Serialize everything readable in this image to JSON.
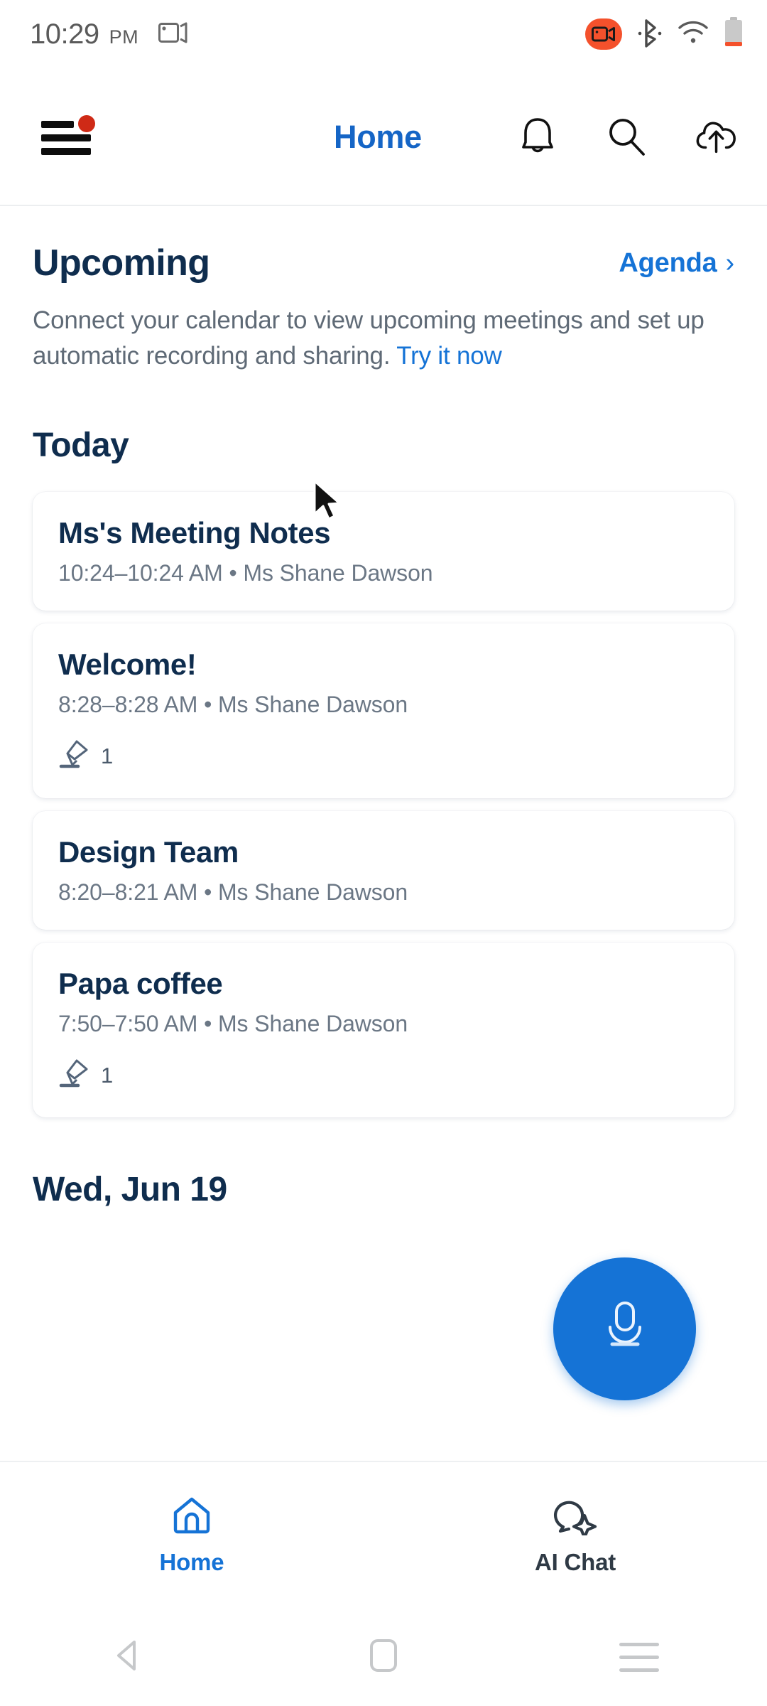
{
  "status_bar": {
    "time": "10:29",
    "ampm": "PM",
    "icons": [
      "screen-cast-icon",
      "screen-record-icon",
      "bluetooth-icon",
      "wifi-icon",
      "battery-icon"
    ],
    "record_color": "#f4512c",
    "battery_color": "#f4512c"
  },
  "app_bar": {
    "menu_icon": "hamburger-menu-icon",
    "menu_badge": true,
    "badge_color": "#cf2a16",
    "title": "Home",
    "title_color": "#1565c6",
    "actions": [
      {
        "name": "notifications-bell-icon",
        "label": "Notifications"
      },
      {
        "name": "search-icon",
        "label": "Search"
      },
      {
        "name": "cloud-upload-icon",
        "label": "Upload"
      }
    ]
  },
  "upcoming": {
    "title": "Upcoming",
    "action_label": "Agenda",
    "action_chevron": "›",
    "description_prefix": "Connect your calendar to view upcoming meetings and set up automatic recording and sharing. ",
    "description_link": "Try it now",
    "accent_color": "#1573d6"
  },
  "today": {
    "heading": "Today",
    "meetings": [
      {
        "title": "Ms's Meeting Notes",
        "time": "10:24–10:24 AM",
        "separator": "•",
        "owner": "Ms Shane Dawson",
        "has_highlight": false,
        "highlight_count": ""
      },
      {
        "title": "Welcome!",
        "time": "8:28–8:28 AM",
        "separator": "•",
        "owner": "Ms Shane Dawson",
        "has_highlight": true,
        "highlight_count": "1"
      },
      {
        "title": "Design Team",
        "time": "8:20–8:21 AM",
        "separator": "•",
        "owner": "Ms Shane Dawson",
        "has_highlight": false,
        "highlight_count": ""
      },
      {
        "title": "Papa coffee",
        "time": "7:50–7:50 AM",
        "separator": "•",
        "owner": "Ms Shane Dawson",
        "has_highlight": true,
        "highlight_count": "1"
      }
    ]
  },
  "next_day": {
    "heading": "Wed, Jun 19"
  },
  "fab": {
    "icon": "microphone-icon",
    "color": "#1573d6"
  },
  "bottom_nav": {
    "items": [
      {
        "label": "Home",
        "icon": "home-icon",
        "active": true
      },
      {
        "label": "AI Chat",
        "icon": "ai-chat-sparkle-icon",
        "active": false
      }
    ],
    "active_color": "#1573d6",
    "idle_color": "#2f3a45"
  },
  "system_nav": {
    "buttons": [
      "back-icon",
      "home-square-icon",
      "recents-icon"
    ]
  }
}
